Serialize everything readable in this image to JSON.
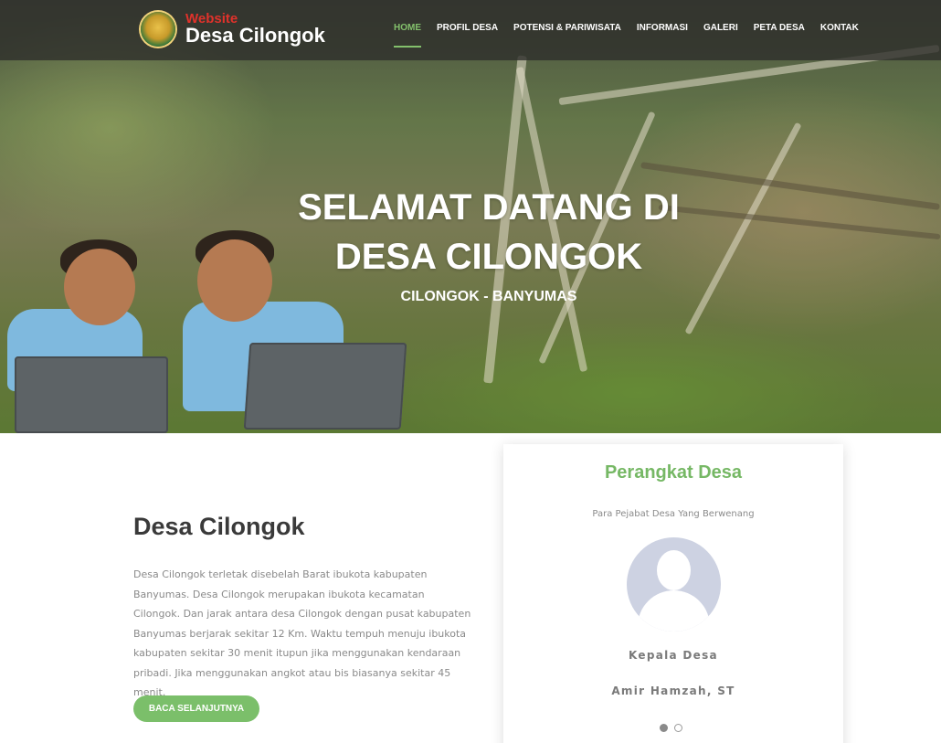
{
  "brand": {
    "small": "Website",
    "big": "Desa Cilongok"
  },
  "nav": {
    "items": [
      {
        "label": "HOME"
      },
      {
        "label": "PROFIL DESA"
      },
      {
        "label": "POTENSI & PARIWISATA"
      },
      {
        "label": "INFORMASI"
      },
      {
        "label": "GALERI"
      },
      {
        "label": "PETA DESA"
      },
      {
        "label": "KONTAK"
      }
    ],
    "active": "HOME"
  },
  "hero": {
    "title_line1": "SELAMAT DATANG DI",
    "title_line2": "DESA CILONGOK",
    "subtitle": "CILONGOK - BANYUMAS"
  },
  "about": {
    "title": "Desa Cilongok",
    "text": "Desa Cilongok terletak disebelah Barat ibukota kabupaten Banyumas. Desa Cilongok merupakan ibukota kecamatan Cilongok. Dan jarak antara desa Cilongok dengan pusat kabupaten Banyumas berjarak sekitar 12 Km. Waktu tempuh menuju ibukota kabupaten sekitar 30 menit itupun jika menggunakan kendaraan pribadi. Jika menggunakan angkot atau bis biasanya sekitar 45 menit.",
    "button": "BACA SELANJUTNYA"
  },
  "officials": {
    "title": "Perangkat Desa",
    "subtitle": "Para Pejabat Desa Yang Berwenang",
    "role": "Kepala Desa",
    "name": "Amir Hamzah, ST",
    "slides_total": 2,
    "slide_active": 1
  },
  "colors": {
    "accent": "#7bbf6a",
    "nav_bg": "#2d2d2a",
    "avatar_bg": "#cdd2e2"
  }
}
